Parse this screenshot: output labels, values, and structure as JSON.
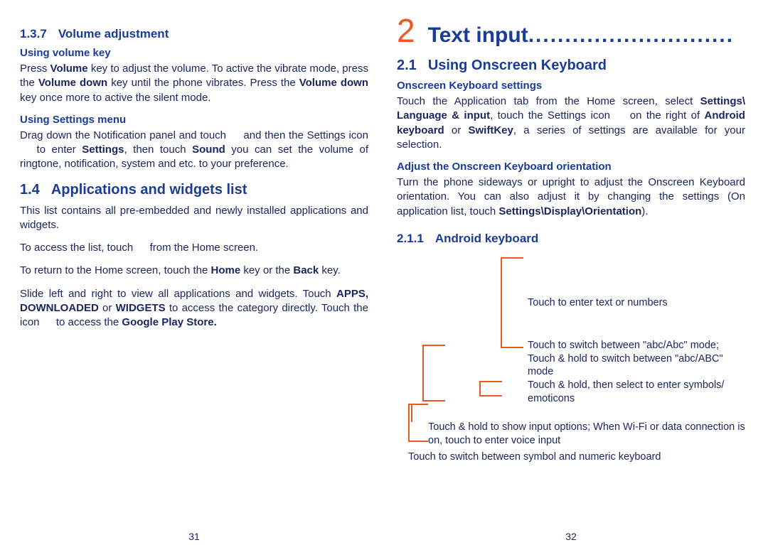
{
  "left": {
    "h137_num": "1.3.7",
    "h137_title": "Volume adjustment",
    "h5_vol_key": "Using volume key",
    "p_vol_key": "Press <b>Volume</b> key to adjust the volume. To active the vibrate mode, press the <b>Volume down</b> key until the phone vibrates. Press the <b>Volume down</b> key once more to active the silent mode.",
    "h5_settings": "Using Settings menu",
    "p_settings": "Drag down the Notification panel and touch   and then the Settings icon   to enter <b>Settings</b>, then touch <b>Sound</b> you can set the volume of ringtone, notification, system and etc. to your preference.",
    "h14_num": "1.4",
    "h14_title": "Applications and widgets list",
    "p14a": "This list contains all pre-embedded and newly installed applications and widgets.",
    "p14b": "To access the list, touch   from the Home screen.",
    "p14c": "To return to the Home screen, touch the <b>Home</b> key or the <b>Back</b> key.",
    "p14d": "Slide left and right to view all applications and widgets. Touch <b>APPS, DOWNLOADED</b> or <b>WIDGETS</b> to access the category directly. Touch the icon   to access the <b>Google Play Store.</b>",
    "pagenum": "31"
  },
  "right": {
    "h2_num": "2",
    "h2_title": "Text input",
    "h21_num": "2.1",
    "h21_title": "Using Onscreen Keyboard",
    "h5_osk": "Onscreen Keyboard settings",
    "p_osk": "Touch the Application tab from the Home screen, select <b>Settings\\ Language &amp; input</b>, touch the Settings icon   on the right of <b>Android keyboard</b> or <b>SwiftKey</b>, a series of settings are available for your selection.",
    "h5_orient": "Adjust the Onscreen Keyboard orientation",
    "p_orient": "Turn the phone sideways or upright to adjust the Onscreen Keyboard orientation. You can also adjust it by changing the settings (On application list, touch <b>Settings\\Display\\Orientation</b>).",
    "h211_num": "2.1.1",
    "h211_title": "Android keyboard",
    "c1": "Touch to enter text or numbers",
    "c2": "Touch to switch between \"abc/Abc\" mode; Touch & hold to switch between \"abc/ABC\" mode",
    "c3": "Touch & hold, then select to enter symbols/ emoticons",
    "c4": "Touch & hold to show input options; When Wi-Fi or data connection is on, touch to enter voice input",
    "c5": "Touch to switch between symbol and numeric keyboard",
    "pagenum": "32"
  }
}
